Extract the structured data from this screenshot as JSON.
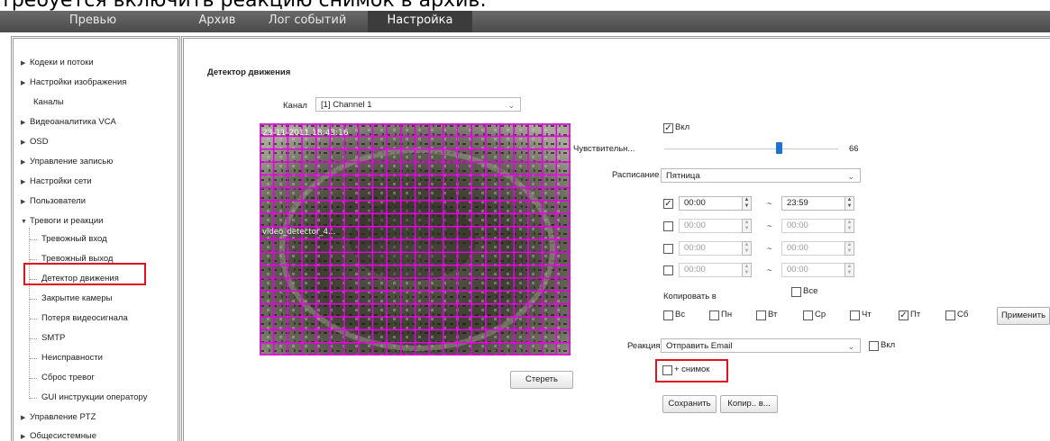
{
  "caption": "требуется включить реакцию снимок в архив:",
  "tabs": [
    "Превью",
    "Архив",
    "Лог событий",
    "Настройка"
  ],
  "sidebar": {
    "items": [
      "Кодеки и потоки",
      "Настройки изображения",
      "Каналы",
      "Видеоаналитика VCA",
      "OSD",
      "Управление записью",
      "Настройки сети",
      "Пользователи",
      "Тревоги и реакции"
    ],
    "subitems": [
      "Тревожный вход",
      "Тревожный выход",
      "Детектор движения",
      "Закрытие камеры",
      "Потеря видеосигнала",
      "SMTP",
      "Неисправности",
      "Сброс тревог",
      "GUI инструкции оператору"
    ],
    "bottom": [
      "Управление PTZ",
      "Общесистемные"
    ]
  },
  "main": {
    "title": "Детектор движения",
    "channel_label": "Канал",
    "channel_value": "[1] Channel 1",
    "video_overlay_time": "23-11-2011 18:43:16",
    "video_overlay_text": "video_detector_4...",
    "clear_button": "Стереть",
    "enable_label": "Вкл",
    "sensitivity_label": "Чувствительн...",
    "sensitivity_value": "66",
    "sensitivity_fraction": 0.66,
    "schedule_label": "Расписание",
    "schedule_day": "Пятница",
    "time_rows": [
      {
        "checked": true,
        "from": "00:00",
        "to": "23:59"
      },
      {
        "checked": false,
        "from": "00:00",
        "to": "00:00"
      },
      {
        "checked": false,
        "from": "00:00",
        "to": "00:00"
      },
      {
        "checked": false,
        "from": "00:00",
        "to": "00:00"
      }
    ],
    "tilde": "~",
    "copy_to_label": "Копировать в",
    "all_label": "Все",
    "days": [
      {
        "label": "Вс",
        "checked": false
      },
      {
        "label": "Пн",
        "checked": false
      },
      {
        "label": "Вт",
        "checked": false
      },
      {
        "label": "Ср",
        "checked": false
      },
      {
        "label": "Чт",
        "checked": false
      },
      {
        "label": "Пт",
        "checked": true
      },
      {
        "label": "Сб",
        "checked": false
      }
    ],
    "apply_button": "Применить",
    "reaction_label": "Реакция",
    "reaction_value": "Отправить Email",
    "reaction_enable_label": "Вкл",
    "snapshot_label": "+ снимок",
    "save_button": "Сохранить",
    "copy_button": "Копир.. в..."
  },
  "colors": {
    "grid": "#e600e6",
    "highlight": "#e0121c",
    "slider": "#1e73d2",
    "topbar": "#5a5a5a"
  }
}
